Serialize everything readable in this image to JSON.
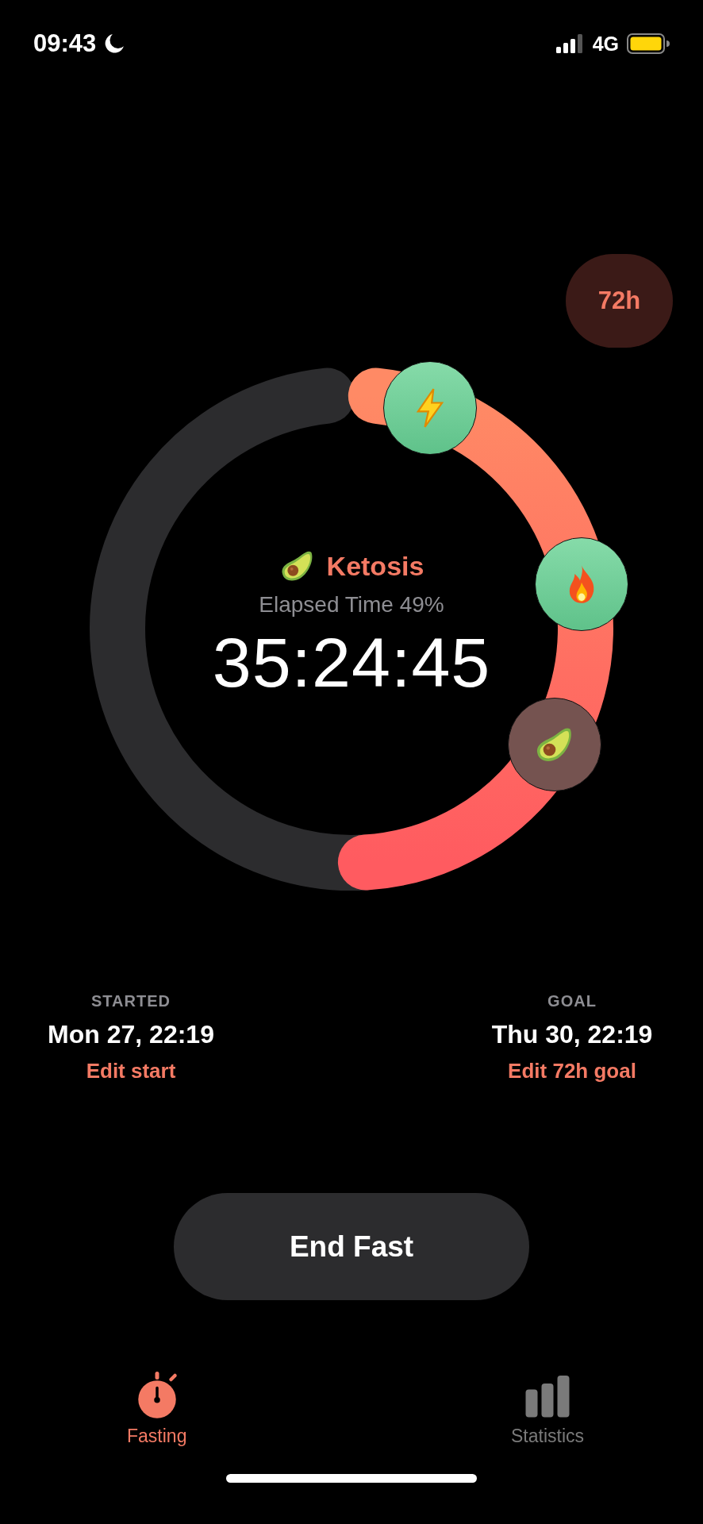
{
  "status_bar": {
    "time": "09:43",
    "network": "4G"
  },
  "goal_badge": {
    "label": "72h"
  },
  "milestones": [
    {
      "kind": "bolt",
      "reached": true
    },
    {
      "kind": "flame",
      "reached": true
    },
    {
      "kind": "avocado",
      "reached": false
    }
  ],
  "stage": {
    "kind": "avocado",
    "name": "Ketosis"
  },
  "elapsed_label": "Elapsed Time 49%",
  "timer": "35:24:45",
  "started": {
    "label": "STARTED",
    "value": "Mon 27, 22:19",
    "link": "Edit start"
  },
  "goal": {
    "label": "GOAL",
    "value": "Thu 30, 22:19",
    "link": "Edit 72h goal"
  },
  "end_button": "End Fast",
  "tabs": [
    {
      "label": "Fasting",
      "kind": "stopwatch",
      "selected": true
    },
    {
      "label": "Statistics",
      "kind": "bars",
      "selected": false
    }
  ]
}
